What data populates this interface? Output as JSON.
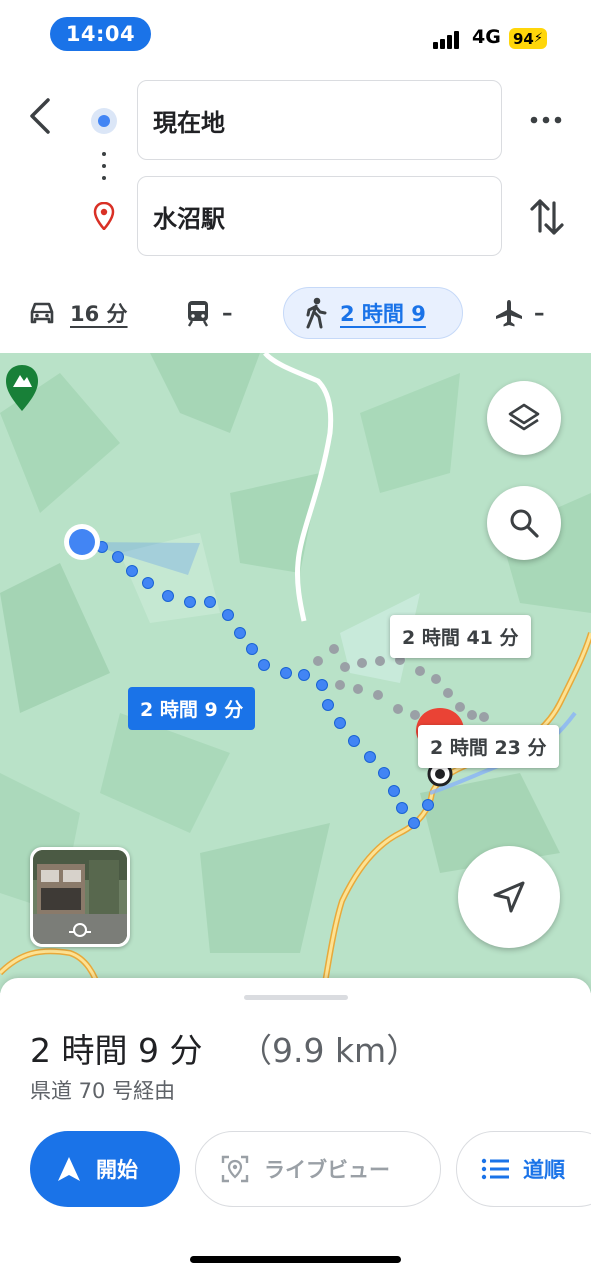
{
  "status_bar": {
    "time": "14:04",
    "network": "4G",
    "battery": "94"
  },
  "header": {
    "origin": "現在地",
    "destination": "水沼駅"
  },
  "modes": {
    "car": {
      "label": "16 分"
    },
    "transit": {
      "label": "–"
    },
    "walk": {
      "label": "2 時間 9"
    },
    "flight": {
      "label": "–"
    },
    "selected": "walk"
  },
  "map": {
    "route_labels": {
      "primary": "2 時間 9 分",
      "alt1": "2 時間 41 分",
      "alt2": "2 時間 23 分"
    },
    "colors": {
      "route": "#4285f4",
      "alt_route": "#9aa0a6",
      "map_green": "#b9e2c8",
      "road": "#f6c26b"
    }
  },
  "sheet": {
    "duration": "2 時間 9 分",
    "distance": "（9.9 km）",
    "via": "県道 70 号経由",
    "buttons": {
      "start": "開始",
      "live_view": "ライブビュー",
      "steps": "道順"
    }
  }
}
